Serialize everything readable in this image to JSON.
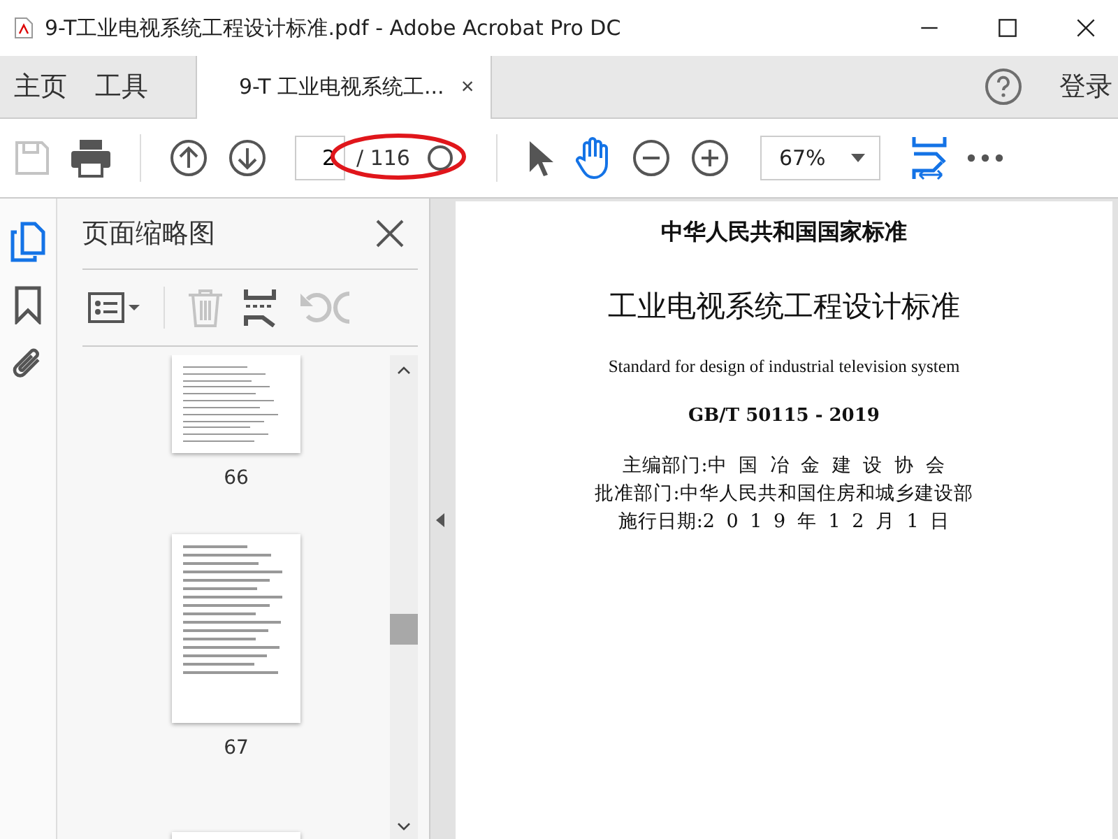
{
  "window": {
    "title": "9-T工业电视系统工程设计标准.pdf - Adobe Acrobat Pro DC"
  },
  "nav_tabs": [
    {
      "label": "主页",
      "selected": false
    },
    {
      "label": "工具",
      "selected": false
    }
  ],
  "document_tab": {
    "label": "9-T 工业电视系统工...",
    "selected": true,
    "close": "×"
  },
  "account": {
    "label": "登录"
  },
  "toolbar": {
    "save": {
      "disabled": true
    },
    "page_field": {
      "value": "2"
    },
    "page_total": "/ 116",
    "zoom": {
      "value": "67%"
    },
    "tools": [
      {
        "kind": "select",
        "selected": false
      },
      {
        "kind": "hand",
        "selected": true
      }
    ]
  },
  "left_rail": [
    {
      "kind": "pages",
      "selected": true
    },
    {
      "kind": "bookmarks",
      "selected": false
    },
    {
      "kind": "attachments",
      "selected": false
    }
  ],
  "thumbnail_panel": {
    "title": "页面缩略图",
    "tools": [
      {
        "kind": "options",
        "disabled": false
      },
      {
        "kind": "delete",
        "disabled": true
      },
      {
        "kind": "extract",
        "disabled": false
      },
      {
        "kind": "rotate",
        "disabled": true
      }
    ],
    "thumbnails": [
      {
        "label": "66"
      },
      {
        "label": "67"
      }
    ]
  },
  "document": {
    "lines": [
      {
        "kind": "heading",
        "text": "中华人民共和国国家标准"
      },
      {
        "kind": "title",
        "text": "工业电视系统工程设计标准"
      },
      {
        "kind": "subtitle",
        "text": "Standard for design of industrial television system"
      },
      {
        "kind": "code",
        "text": "GB/T 50115 - 2019"
      },
      {
        "kind": "info",
        "text": "主编部门:中 国 冶 金 建 设 协 会"
      },
      {
        "kind": "info",
        "text": "批准部门:中华人民共和国住房和城乡建设部"
      },
      {
        "kind": "info",
        "text": "施行日期:2 0 1 9 年 1 2 月 1 日"
      }
    ]
  }
}
